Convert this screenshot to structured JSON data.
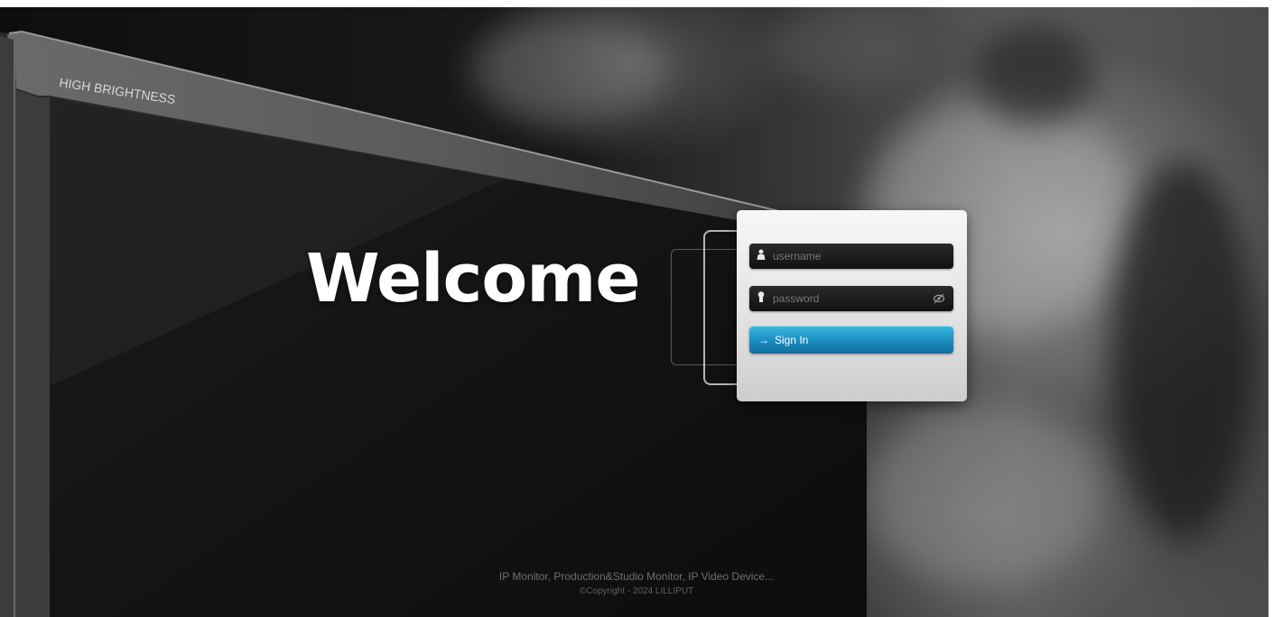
{
  "page": {
    "background_label": "HIGH BRIGHTNESS",
    "welcome_title": "Welcome"
  },
  "login": {
    "username_placeholder": "username",
    "password_placeholder": "password",
    "signin_label": "Sign In",
    "accent_color": "#1b8ec2"
  },
  "footer": {
    "tagline": "IP Monitor, Production&Studio Monitor, IP Video Device...",
    "copyright": "©Copyright - 2024 LILLIPUT"
  },
  "icons": {
    "username": "user-icon",
    "password": "keyhole-icon",
    "toggle": "eye-slash-icon",
    "signin": "arrow-right-icon"
  }
}
